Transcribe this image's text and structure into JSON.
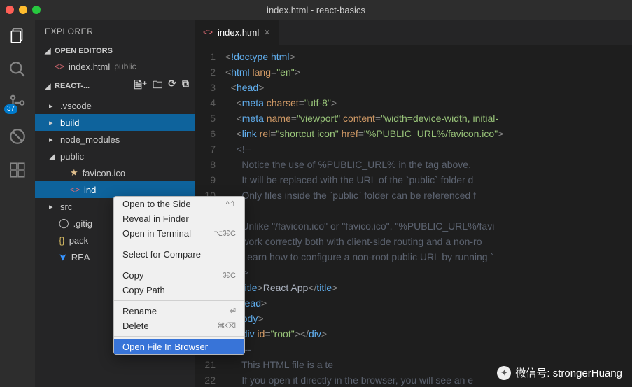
{
  "window": {
    "title": "index.html - react-basics"
  },
  "activity": {
    "badge": "37"
  },
  "explorer": {
    "title": "EXPLORER",
    "openEditors": "OPEN EDITORS",
    "openFile": {
      "name": "index.html",
      "dir": "public"
    },
    "project": "REACT-...",
    "tree": {
      "vscode": ".vscode",
      "build": "build",
      "node_modules": "node_modules",
      "public": "public",
      "favicon": "favicon.ico",
      "index": "ind",
      "src": "src",
      "gitignore": ".gitig",
      "package": "pack",
      "readme": "REA"
    }
  },
  "tab": {
    "name": "index.html"
  },
  "code": {
    "l1a": "!doctype html",
    "l2a": "html",
    "l2b": "lang",
    "l2c": "\"en\"",
    "l3": "head",
    "l4a": "meta",
    "l4b": "charset",
    "l4c": "\"utf-8\"",
    "l5a": "meta",
    "l5b": "name",
    "l5c": "\"viewport\"",
    "l5d": "content",
    "l5e": "\"width=device-width, initial-",
    "l6a": "link",
    "l6b": "rel",
    "l6c": "\"shortcut icon\"",
    "l6d": "href",
    "l6e": "\"%PUBLIC_URL%/favicon.ico\"",
    "l7": "<!--",
    "l8": "      Notice the use of %PUBLIC_URL% in the tag above.",
    "l9": "      It will be replaced with the URL of the `public` folder d",
    "l10": "      Only files inside the `public` folder can be referenced f",
    "l11": "",
    "l12": "      Unlike \"/favicon.ico\" or \"favico.ico\", \"%PUBLIC_URL%/favi",
    "l13": "      work correctly both with client-side routing and a non-ro",
    "l14": "      Learn how to configure a non-root public URL by running `",
    "l15": "-->",
    "l16a": "title",
    "l16b": "React App",
    "l17": "head",
    "l18": "body",
    "l19a": "div",
    "l19b": "id",
    "l19c": "\"root\"",
    "l20": "<!--",
    "l21": "      This HTML file is a te",
    "l22": "      If you open it directly in the browser, you will see an e"
  },
  "context": {
    "openSide": "Open to the Side",
    "openSideK": "^⇧",
    "reveal": "Reveal in Finder",
    "terminal": "Open in Terminal",
    "terminalK": "⌥⌘C",
    "select": "Select for Compare",
    "copy": "Copy",
    "copyK": "⌘C",
    "copyPath": "Copy Path",
    "rename": "Rename",
    "renameK": "⏎",
    "delete": "Delete",
    "deleteK": "⌘⌫",
    "browser": "Open File In Browser"
  },
  "watermark": "微信号: strongerHuang"
}
